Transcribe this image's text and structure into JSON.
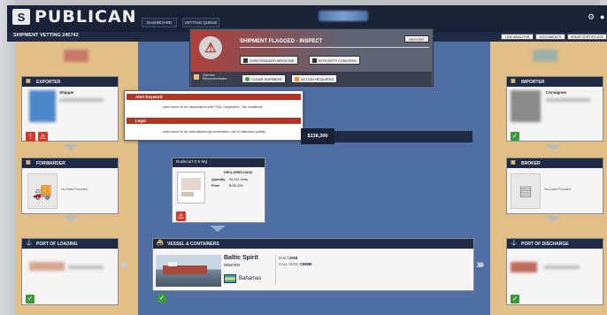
{
  "app": {
    "brand": "PUBLICAN"
  },
  "nav": {
    "tabs": [
      "DASHBOARD",
      "VETTING QUEUE"
    ],
    "center_label": "OPEN"
  },
  "subbar": {
    "title": "SHIPMENT VETTING 245742",
    "buttons": [
      "LINK ANALYSIS",
      "DOCUMENTS",
      "ISSUE CERTIFICATE"
    ]
  },
  "flag_panel": {
    "title": "SHIPMENT FLAGGED - INSPECT",
    "history_label": "HISTORY",
    "tags": [
      "SUBSTANDARD MEDICINE",
      "INTEGRITY CONCERN"
    ],
    "operator_label": "Operator\nRecommendation",
    "clear_label": "CLEAR SHIPMENT",
    "action_label": "ACTION REQUIRED"
  },
  "exporter": {
    "title": "EXPORTER",
    "role": "Shipper"
  },
  "alerts": [
    {
      "heading": "Alert Keyword",
      "text": "...was found to be associated with FDA, Inspection, Tax violations"
    },
    {
      "heading": "Legal",
      "text": "...was found to be manufacturing medication not of standard quality"
    }
  ],
  "value_tag": "$136,300",
  "forwarder": {
    "title": "FORWARDER",
    "no_data": "No Data Provided"
  },
  "cargo": {
    "title": "Budecort 0.5 Mg",
    "declared_heading": "DECLARED DATA",
    "quantity_label": "Quantity",
    "quantity_value": "96,321 Units",
    "price_label": "Price",
    "price_value": "$136,300"
  },
  "importer": {
    "title": "IMPORTER",
    "role": "Consignee"
  },
  "broker": {
    "title": "BROKER",
    "no_data": "No Data Provided"
  },
  "port_loading": {
    "title": "PORT OF LOADING"
  },
  "vessel": {
    "section_title": "VESSEL & CONTAINERS",
    "name": "Baltic Spirit",
    "type": "REEFER",
    "flag_country": "Bahamas",
    "built_label": "BUILT",
    "built_value": "2018",
    "call_sign_label": "CALL SIGN",
    "call_sign_value": "C6EB8"
  },
  "port_discharge": {
    "title": "PORT OF DISCHARGE"
  },
  "colors": {
    "navy": "#1f2a44",
    "sand": "#e2bf86",
    "center_blue": "#4f6fa4",
    "alert_red": "#b23424",
    "ok_green": "#3a9a3a"
  },
  "icons": [
    "logo-icon",
    "settings-icon",
    "user-icon",
    "exporter-icon",
    "importer-icon",
    "forwarder-truck-icon",
    "broker-id-icon",
    "port-icon",
    "ship-icon",
    "warning-icon",
    "check-icon",
    "alert-icon"
  ]
}
